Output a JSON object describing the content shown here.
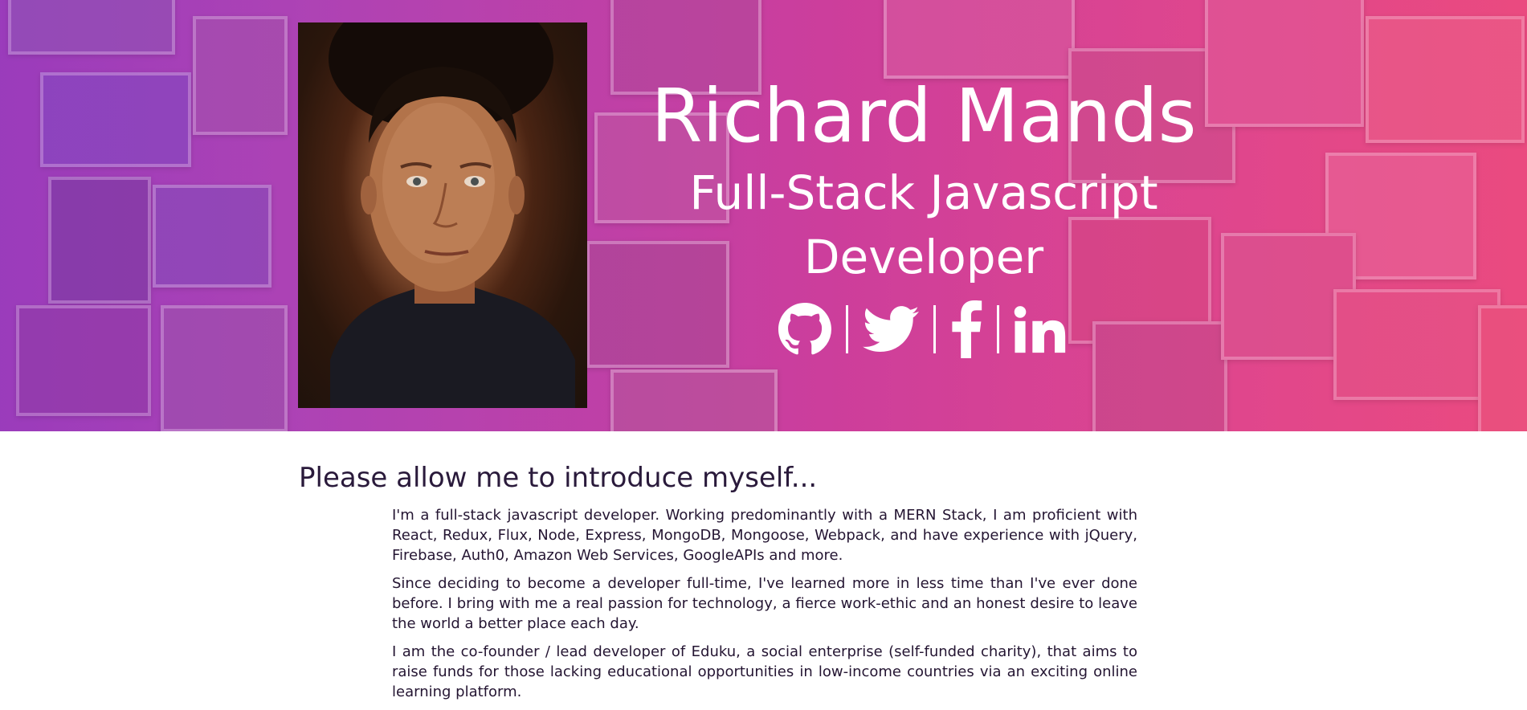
{
  "colors": {
    "accent_start": "#9a3bb8",
    "accent_end": "#e94f7c",
    "text_dark": "#241532"
  },
  "hero": {
    "name": "Richard Mands",
    "role": "Full-Stack Javascript Developer",
    "portrait_alt": "portrait-photo",
    "social": [
      {
        "id": "github",
        "icon": "github-icon"
      },
      {
        "id": "twitter",
        "icon": "twitter-icon"
      },
      {
        "id": "facebook",
        "icon": "facebook-icon"
      },
      {
        "id": "linkedin",
        "icon": "linkedin-icon"
      }
    ]
  },
  "about": {
    "heading": "Please allow me to introduce myself...",
    "paragraphs": [
      "I'm a full-stack javascript developer. Working predominantly with a MERN Stack, I am proficient with React, Redux, Flux, Node, Express, MongoDB, Mongoose, Webpack, and have experience with jQuery, Firebase, Auth0, Amazon Web Services, GoogleAPIs and more.",
      "Since deciding to become a developer full-time, I've learned more in less time than I've ever done before. I bring with me a real passion for technology, a fierce work-ethic and an honest desire to leave the world a better place each day.",
      "I am the co-founder / lead developer of Eduku, a social enterprise (self-funded charity), that aims to raise funds for those lacking educational opportunities in low-income countries via an exciting online learning platform."
    ]
  }
}
